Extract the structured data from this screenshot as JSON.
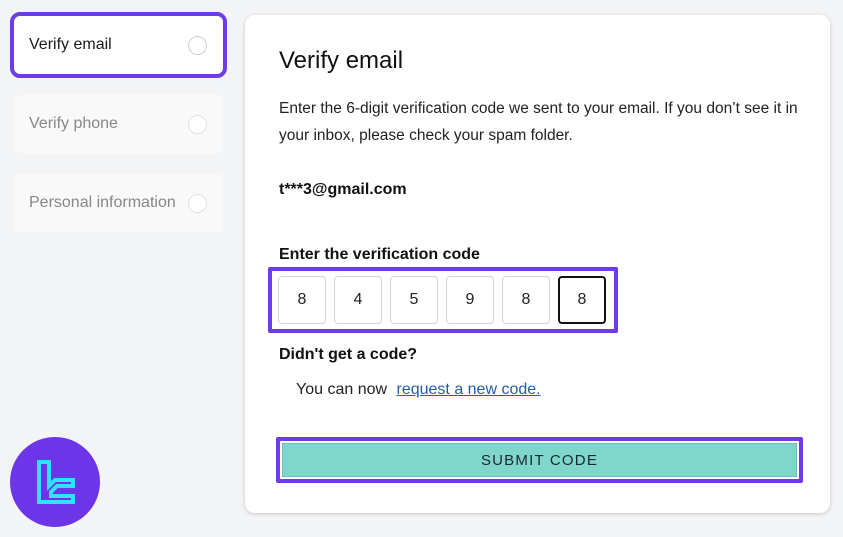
{
  "steps": [
    {
      "label": "Verify email",
      "active": true
    },
    {
      "label": "Verify phone",
      "active": false
    },
    {
      "label": "Personal information",
      "active": false
    }
  ],
  "card": {
    "title": "Verify email",
    "description": "Enter the 6-digit verification code we sent to your email. If you don’t see it in your inbox, please check your spam folder.",
    "email": "t***3@gmail.com",
    "code_label": "Enter the verification code",
    "code_digits": [
      "8",
      "4",
      "5",
      "9",
      "8",
      "8"
    ],
    "no_code_heading": "Didn't get a code?",
    "resend_prefix": "You can now",
    "resend_link": "request a new code.",
    "submit_label": "SUBMIT CODE"
  },
  "colors": {
    "highlight": "#6c3ce9",
    "submit_bg": "#7fd6cc",
    "logo_bg": "#6e35e8",
    "logo_mark": "#2fe3ff"
  },
  "logo_icon": "brand-logo-icon"
}
